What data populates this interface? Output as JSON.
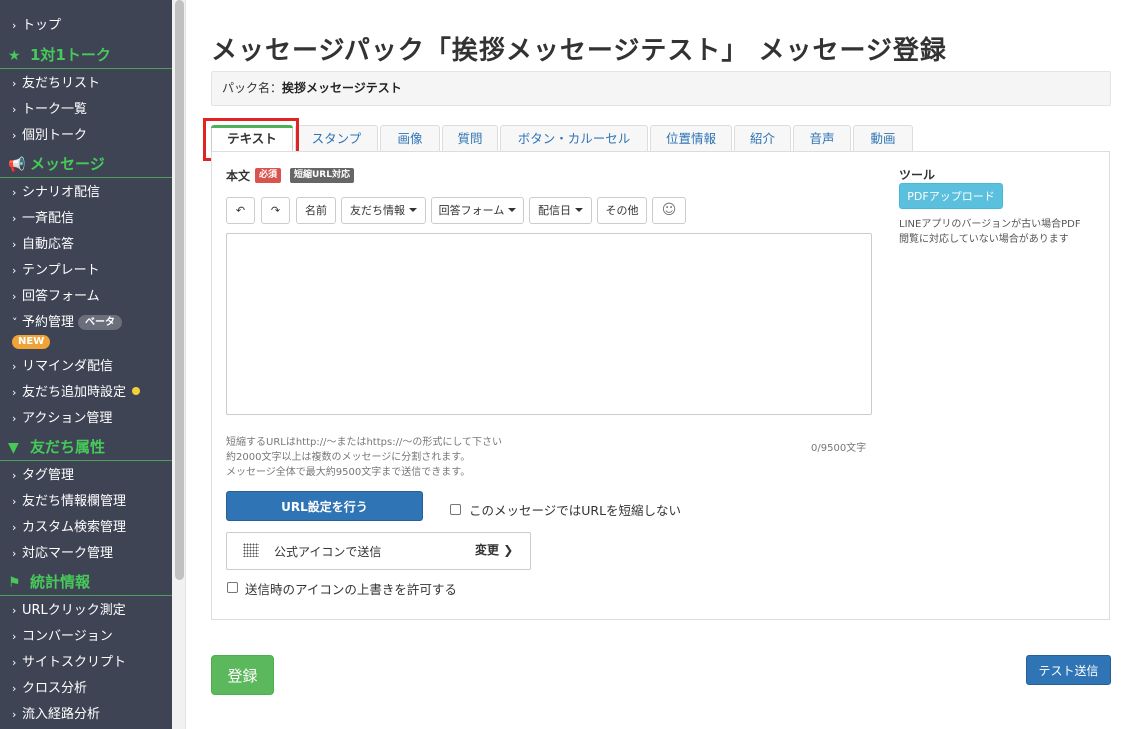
{
  "sidebar": {
    "items": {
      "top": "トップ",
      "friends_list": "友だちリスト",
      "talk_list": "トーク一覧",
      "individual_talk": "個別トーク",
      "scenario": "シナリオ配信",
      "broadcast": "一斉配信",
      "auto_reply": "自動応答",
      "template": "テンプレート",
      "answer_form": "回答フォーム",
      "reservation": "予約管理",
      "reminder": "リマインダ配信",
      "friend_add_settings": "友だち追加時設定",
      "action": "アクション管理",
      "tag": "タグ管理",
      "friend_info_fields": "友だち情報欄管理",
      "custom_search": "カスタム検索管理",
      "mark": "対応マーク管理",
      "url_click": "URLクリック測定",
      "conversion": "コンバージョン",
      "site_script": "サイトスクリプト",
      "cross_analysis": "クロス分析",
      "inflow_analysis": "流入経路分析"
    },
    "sections": {
      "talk": "1対1トーク",
      "message": "メッセージ",
      "attributes": "友だち属性",
      "stats": "統計情報"
    },
    "badges": {
      "beta": "ベータ",
      "new": "NEW"
    }
  },
  "page": {
    "title": "メッセージパック「挨拶メッセージテスト」 メッセージ登録",
    "pack_label": "パック名：",
    "pack_name": "挨拶メッセージテスト"
  },
  "tabs": [
    "テキスト",
    "スタンプ",
    "画像",
    "質問",
    "ボタン・カルーセル",
    "位置情報",
    "紹介",
    "音声",
    "動画"
  ],
  "editor": {
    "body_label": "本文",
    "required_tag": "必須",
    "short_url_tag": "短縮URL対応",
    "toolbar": {
      "undo": "↶",
      "redo": "↷",
      "name": "名前",
      "friend_info": "友だち情報",
      "answer_form": "回答フォーム",
      "send_date": "配信日",
      "other": "その他",
      "emoji": "☺"
    },
    "textarea_value": "",
    "help_lines": [
      "短縮するURLはhttp://〜またはhttps://〜の形式にして下さい",
      "約2000文字以上は複数のメッセージに分割されます。",
      "メッセージ全体で最大約9500文字まで送信できます。"
    ],
    "counter": "0/9500文字",
    "url_button": "URL設定を行う",
    "no_shorten_label": "このメッセージではURLを短縮しない",
    "icon_send_label": "公式アイコンで送信",
    "change_label": "変更",
    "allow_override_label": "送信時のアイコンの上書きを許可する"
  },
  "tools": {
    "title": "ツール",
    "pdf_button": "PDFアップロード",
    "note_lines": [
      "LINEアプリのバージョンが古い場合PDF",
      "閲覧に対応していない場合があります"
    ]
  },
  "footer": {
    "save_button": "登録",
    "test_send_button": "テスト送信"
  },
  "colors": {
    "sidebar_bg": "#3f4454",
    "section_green": "#47c95a",
    "primary_blue": "#2f74b5",
    "success_green": "#5cb85c",
    "info_cyan": "#5bc0de",
    "highlight_red": "#e02424"
  }
}
